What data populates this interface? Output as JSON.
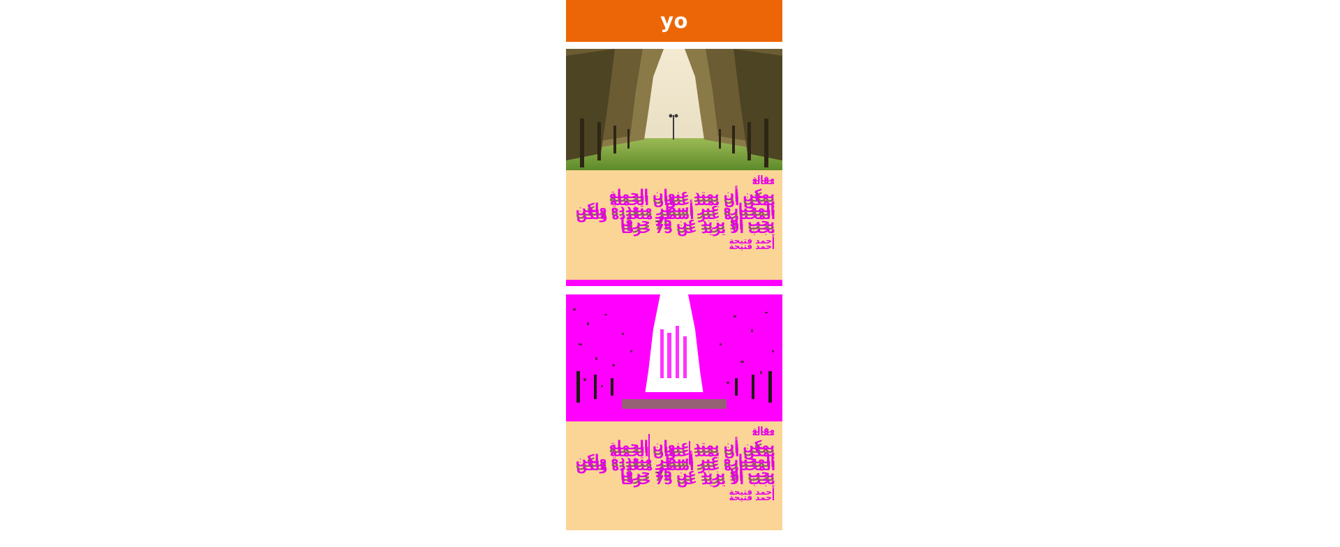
{
  "header": {
    "title": "yo",
    "background": "#ec6608"
  },
  "cards": [
    {
      "label": "مقالة",
      "headline": "يمكن أن يمتد عنوان الجملة المختارة عبر أسطر متعددة ولكن يجب ألا يزيد عن 75 حرفًا",
      "author": "أحمد فتيحة",
      "image": "palm-avenue-photo"
    },
    {
      "label": "مقالة",
      "headline": "يمكن أن يمتد عنوان الجملة المختارة عبر أسطر متعددة ولكن يجب ألا يزيد عن 75 حرفًا",
      "author": "أحمد فتيحة",
      "image": "palm-avenue-photo-magenta"
    }
  ],
  "colors": {
    "card_background": "#fbd595",
    "text_magenta": "#e600e6",
    "accent_bar": "#ff00ff"
  }
}
